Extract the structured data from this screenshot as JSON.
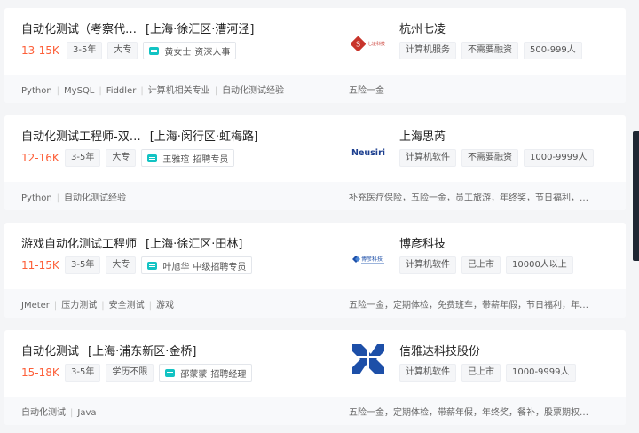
{
  "jobs": [
    {
      "title": "自动化测试（考察代…",
      "location": "[上海·徐汇区·漕河泾]",
      "salary": "13-15K",
      "experience": "3-5年",
      "education": "大专",
      "recruiter_name": "黄女士",
      "recruiter_role": "资深人事",
      "skills": [
        "Python",
        "MySQL",
        "Fiddler",
        "计算机相关专业",
        "自动化测试经验"
      ],
      "company": "杭州七凌",
      "logo_icon": "qiling-logo-icon",
      "company_tags": [
        "计算机服务",
        "不需要融资",
        "500-999人"
      ],
      "benefits": "五险一金"
    },
    {
      "title": "自动化测试工程师-双…",
      "location": "[上海·闵行区·虹梅路]",
      "salary": "12-16K",
      "experience": "3-5年",
      "education": "大专",
      "recruiter_name": "王雅瑄",
      "recruiter_role": "招聘专员",
      "skills": [
        "Python",
        "自动化测试经验"
      ],
      "company": "上海思芮",
      "logo_icon": "neusiri-logo-icon",
      "company_tags": [
        "计算机软件",
        "不需要融资",
        "1000-9999人"
      ],
      "benefits": "补充医疗保险，五险一金，员工旅游，年终奖，节日福利，…"
    },
    {
      "title": "游戏自动化测试工程师",
      "location": "[上海·徐汇区·田林]",
      "salary": "11-15K",
      "experience": "3-5年",
      "education": "大专",
      "recruiter_name": "叶旭华",
      "recruiter_role": "中级招聘专员",
      "skills": [
        "JMeter",
        "压力测试",
        "安全测试",
        "游戏"
      ],
      "company": "博彦科技",
      "logo_icon": "beyondsoft-logo-icon",
      "company_tags": [
        "计算机软件",
        "已上市",
        "10000人以上"
      ],
      "benefits": "五险一金，定期体检，免费班车，带薪年假，节日福利，年…"
    },
    {
      "title": "自动化测试",
      "location": "[上海·浦东新区·金桥]",
      "salary": "15-18K",
      "experience": "3-5年",
      "education": "学历不限",
      "recruiter_name": "邵蒙蒙",
      "recruiter_role": "招聘经理",
      "skills": [
        "自动化测试",
        "Java"
      ],
      "company": "信雅达科技股份",
      "logo_icon": "sunyard-logo-icon",
      "company_tags": [
        "计算机软件",
        "已上市",
        "1000-9999人"
      ],
      "benefits": "五险一金，定期体检，带薪年假，年终奖，餐补，股票期权…"
    }
  ],
  "logos": {
    "qiling_text": "七凌科技",
    "neusiri_text": "Neusiri",
    "beyondsoft_text": "博彦科技"
  },
  "colors": {
    "salary": "#fd5f39",
    "chat_icon": "#12c3c3",
    "sunyard_blue": "#1d4fa8"
  }
}
